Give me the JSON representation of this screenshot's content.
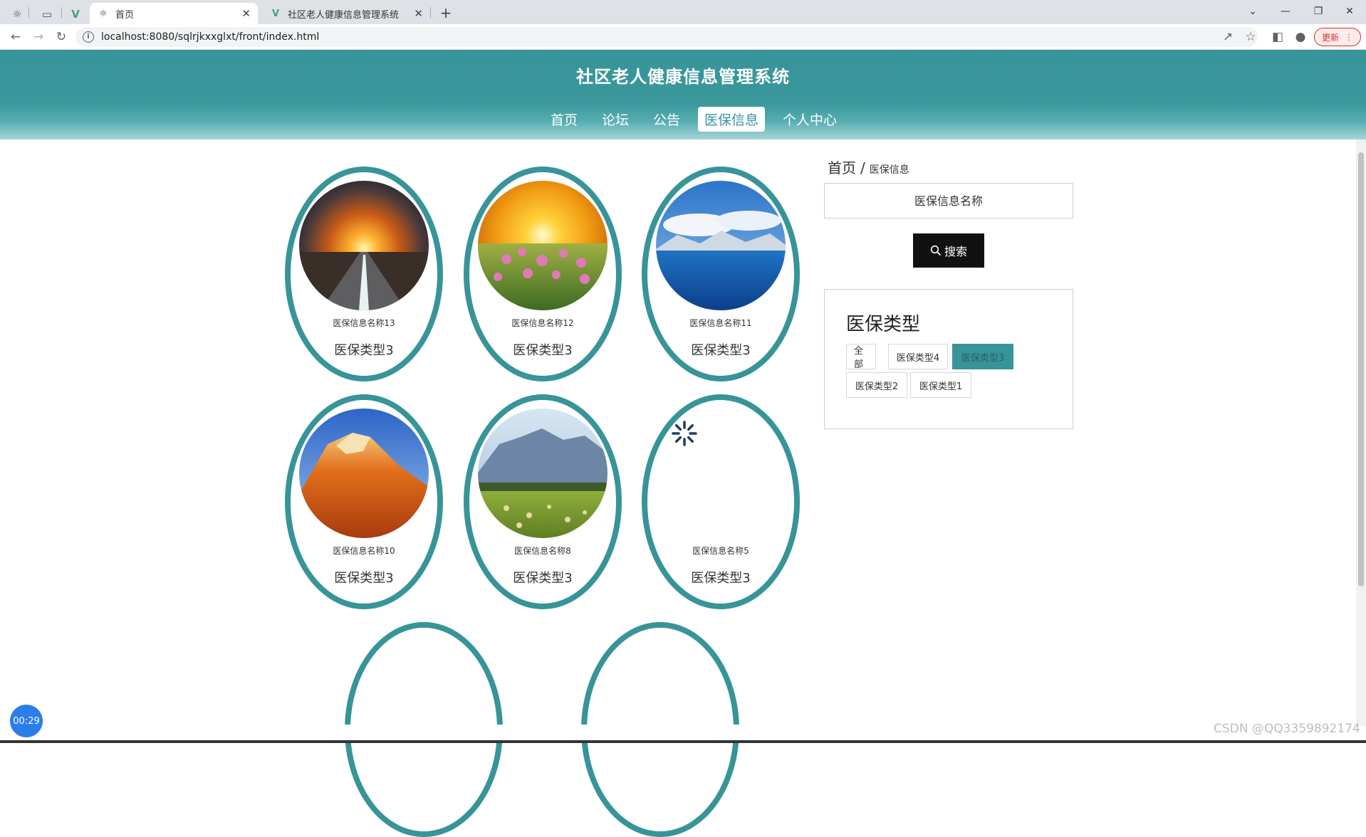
{
  "browser": {
    "tabs": [
      {
        "title": "首页",
        "active": true
      },
      {
        "title": "社区老人健康信息管理系统",
        "active": false
      }
    ],
    "url": "localhost:8080/sqlrjkxxglxt/front/index.html",
    "update_label": "更新"
  },
  "site": {
    "title": "社区老人健康信息管理系统",
    "nav": [
      "首页",
      "论坛",
      "公告",
      "医保信息",
      "个人中心"
    ],
    "active_nav": "医保信息"
  },
  "cards": [
    {
      "name": "医保信息名称13",
      "type": "医保类型3",
      "image": "sunset-road"
    },
    {
      "name": "医保信息名称12",
      "type": "医保类型3",
      "image": "flower-field"
    },
    {
      "name": "医保信息名称11",
      "type": "医保类型3",
      "image": "snow-lake"
    },
    {
      "name": "医保信息名称10",
      "type": "医保类型3",
      "image": "red-rock"
    },
    {
      "name": "医保信息名称8",
      "type": "医保类型3",
      "image": "mountain-meadow"
    },
    {
      "name": "医保信息名称5",
      "type": "医保类型3",
      "image": "loading"
    }
  ],
  "sidebar": {
    "breadcrumb": {
      "home": "首页",
      "separator": "/",
      "current": "医保信息"
    },
    "search": {
      "placeholder": "医保信息名称",
      "value": "",
      "button_label": "搜索"
    },
    "filter": {
      "title": "医保类型",
      "options": [
        "全部",
        "医保类型4",
        "医保类型3",
        "医保类型2",
        "医保类型1"
      ],
      "selected": "医保类型3"
    }
  },
  "timer": "00:29",
  "watermark": "CSDN @QQ3359892174",
  "colors": {
    "accent": "#379499",
    "search_button": "#111111",
    "timer": "#2b7de9"
  }
}
